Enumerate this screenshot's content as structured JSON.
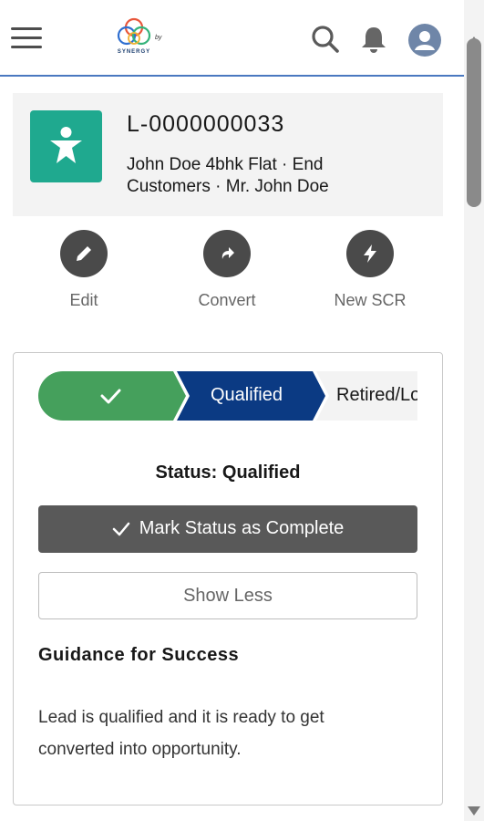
{
  "header": {
    "logo_text": "SYNERGY",
    "logo_by": "by"
  },
  "record": {
    "id": "L-0000000033",
    "subtitle": "John Doe 4bhk Flat  ·  End Customers  ·  Mr. John Doe",
    "icon_color": "#1fa98f"
  },
  "actions": [
    {
      "label": "Edit",
      "icon": "pencil-icon"
    },
    {
      "label": "Convert",
      "icon": "convert-arrow-icon"
    },
    {
      "label": "New SCR",
      "icon": "lightning-bolt-icon"
    }
  ],
  "path": {
    "stages": [
      {
        "label": "",
        "state": "complete",
        "color": "#45a05c"
      },
      {
        "label": "Qualified",
        "state": "current",
        "color": "#0b3a83"
      },
      {
        "label": "Retired/Lost",
        "state": "incomplete",
        "color": "#f3f3f3"
      }
    ],
    "status_text": "Status: Qualified",
    "mark_button": "Mark Status as Complete",
    "show_less_button": "Show Less",
    "guidance_title": "Guidance for Success",
    "guidance_text": "Lead is qualified and it is ready to get converted into opportunity."
  },
  "colors": {
    "header_accent": "#4a78c0",
    "action_circle": "#4a4a4a",
    "mark_button_bg": "#595959"
  }
}
